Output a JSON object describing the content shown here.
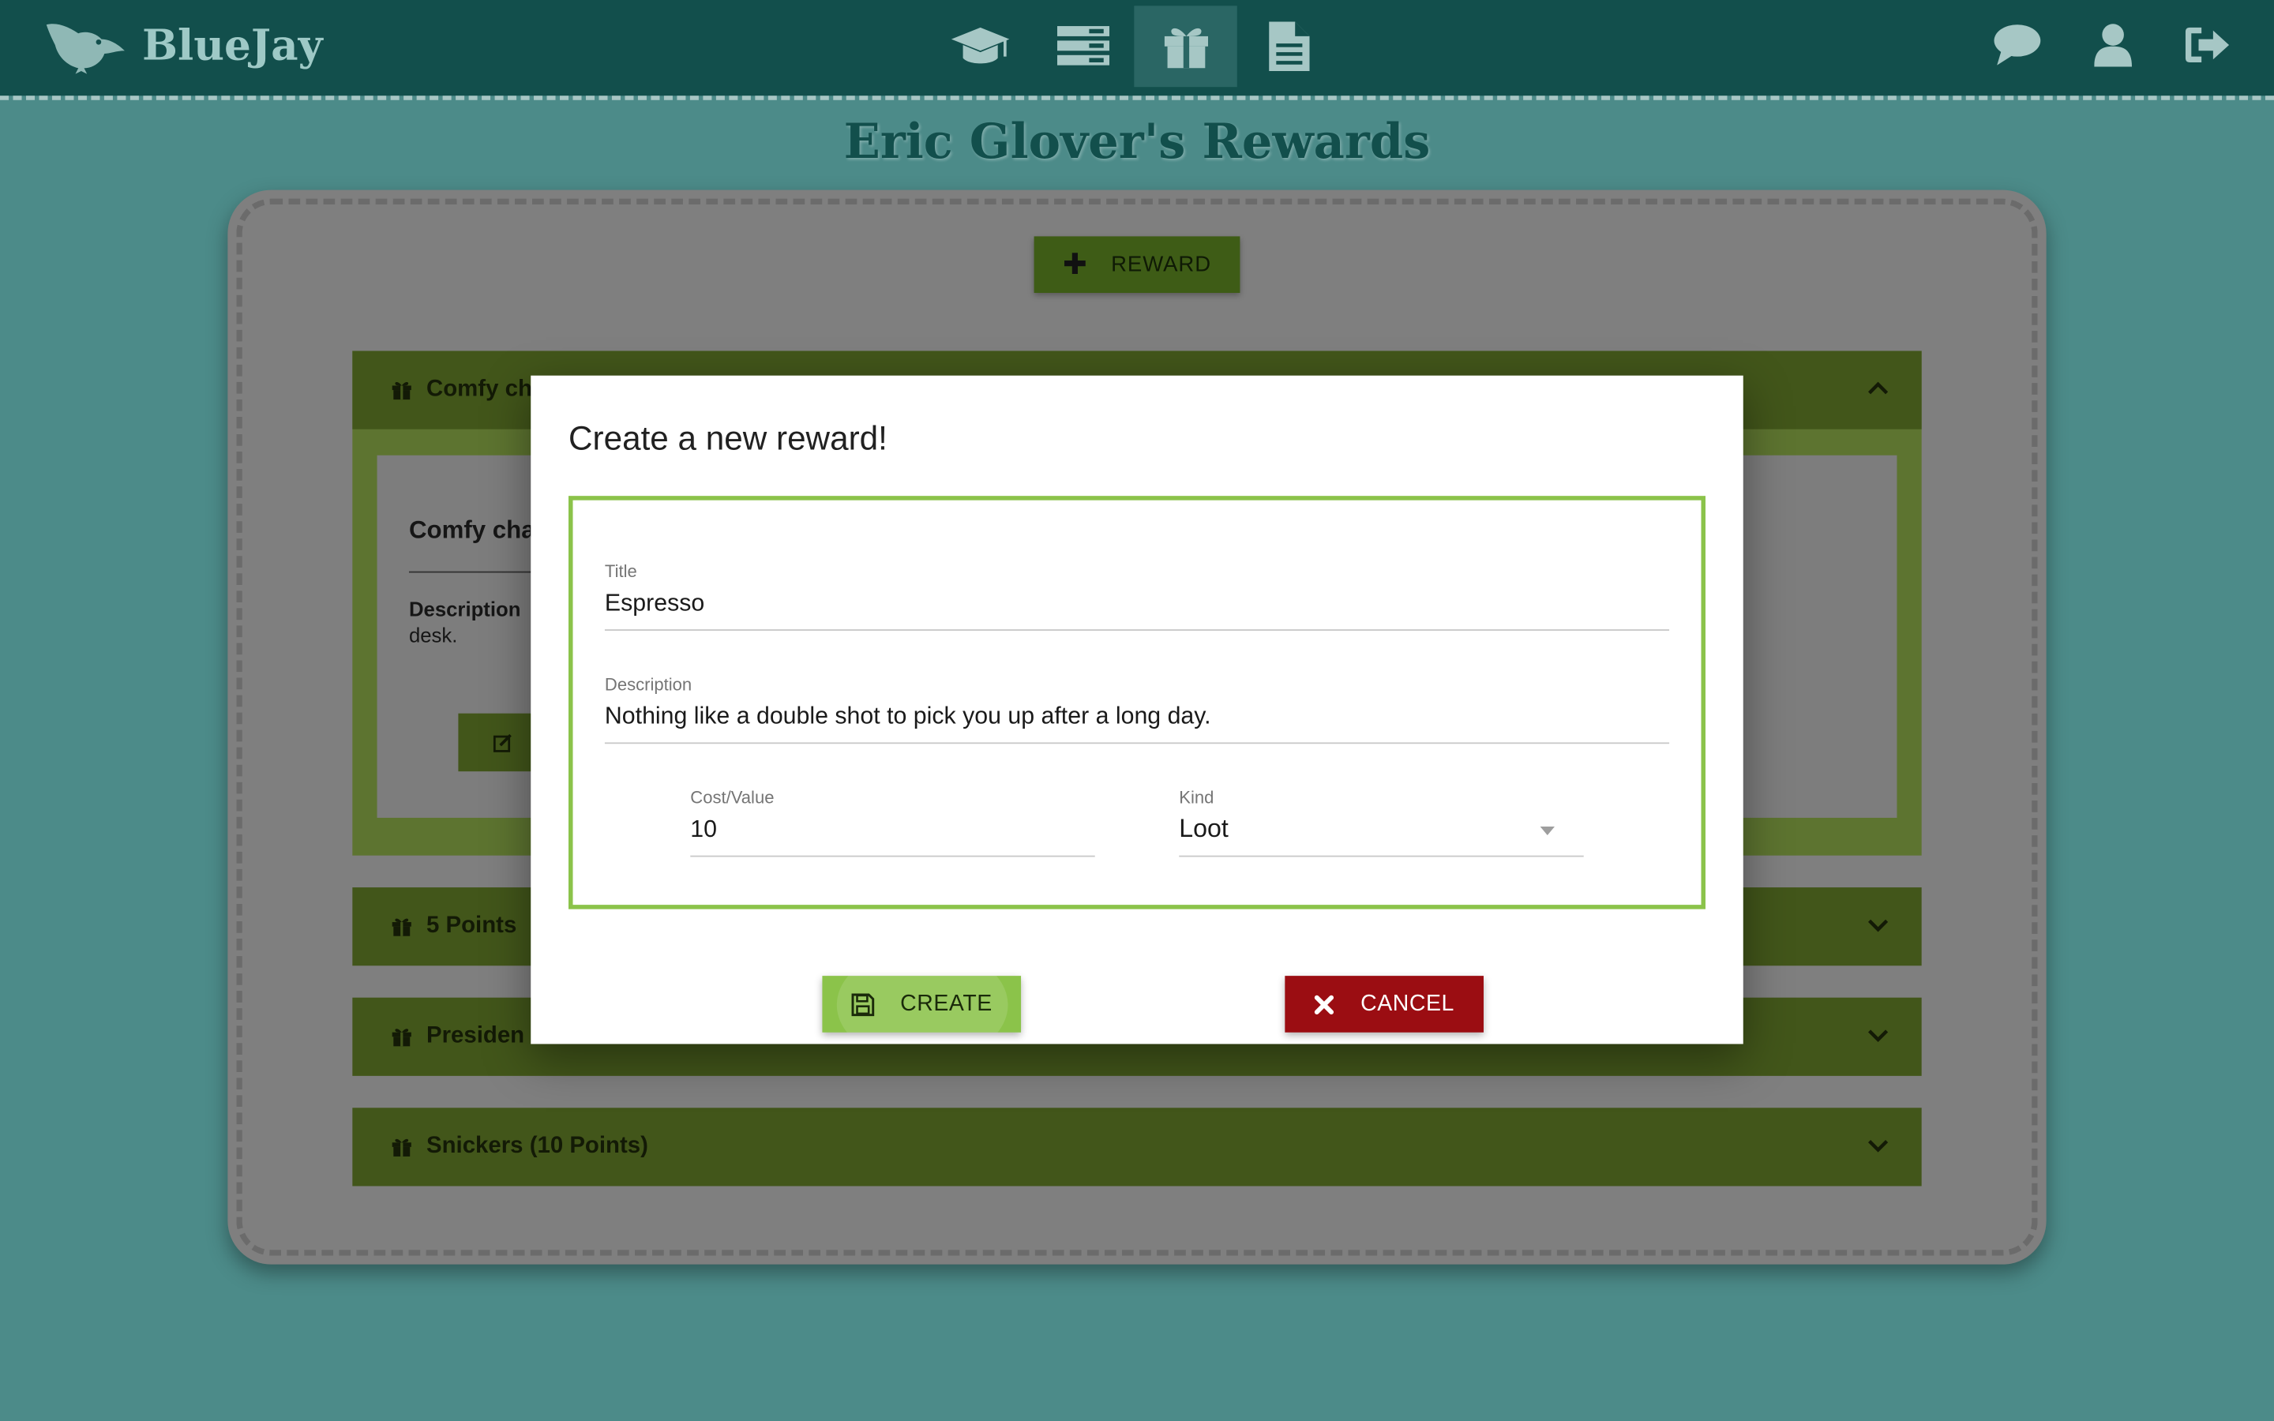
{
  "app": {
    "name": "BlueJay"
  },
  "nav": {
    "tabs": [
      {
        "name": "classes",
        "icon": "graduation-cap-icon",
        "active": false
      },
      {
        "name": "tasks",
        "icon": "list-icon",
        "active": false
      },
      {
        "name": "rewards",
        "icon": "gift-icon",
        "active": true
      },
      {
        "name": "documents",
        "icon": "document-icon",
        "active": false
      }
    ],
    "right": [
      "chat-icon",
      "user-icon",
      "logout-icon"
    ]
  },
  "page": {
    "title": "Eric Glover's Rewards",
    "add_button_label": "REWARD"
  },
  "rewards": [
    {
      "label": "Comfy ch",
      "expanded": true
    },
    {
      "label": "5 Points ",
      "expanded": false
    },
    {
      "label": "Presiden",
      "expanded": false
    },
    {
      "label": "Snickers (10 Points)",
      "expanded": false
    }
  ],
  "expanded_card": {
    "title": "Comfy cha",
    "description_label": "Description",
    "description_tail": "desk."
  },
  "modal": {
    "title": "Create a new reward!",
    "fields": {
      "title_label": "Title",
      "title_value": "Espresso",
      "description_label": "Description",
      "description_value": "Nothing like a double shot to pick you up after a long day.",
      "cost_label": "Cost/Value",
      "cost_value": "10",
      "kind_label": "Kind",
      "kind_value": "Loot"
    },
    "create_label": "CREATE",
    "cancel_label": "CANCEL"
  },
  "colors": {
    "navbar": "#124f4c",
    "background": "#4c8b89",
    "accent_green": "#8bc34a",
    "cancel_red": "#9b0d12"
  }
}
